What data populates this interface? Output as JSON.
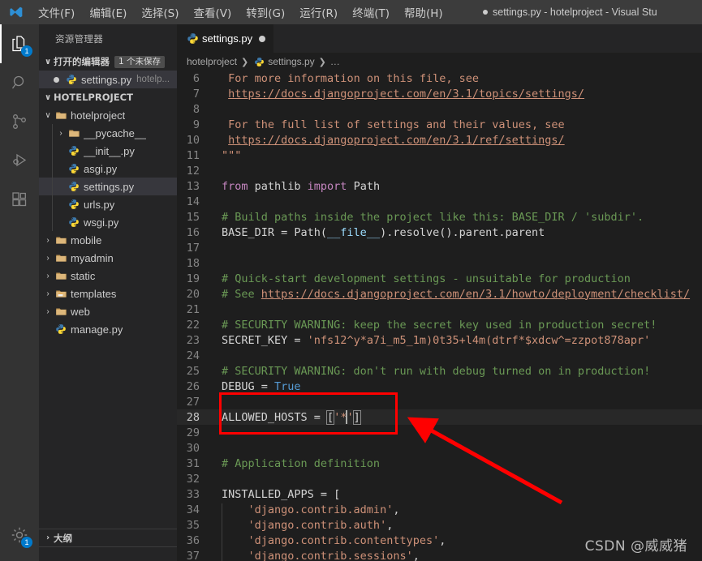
{
  "titlebar": {
    "logo": "vscode-logo",
    "menus": [
      {
        "label": "文件(F)"
      },
      {
        "label": "编辑(E)"
      },
      {
        "label": "选择(S)"
      },
      {
        "label": "查看(V)"
      },
      {
        "label": "转到(G)"
      },
      {
        "label": "运行(R)"
      },
      {
        "label": "终端(T)"
      },
      {
        "label": "帮助(H)"
      }
    ],
    "window_title": "settings.py - hotelproject - Visual Stu"
  },
  "activitybar": {
    "items": [
      {
        "name": "explorer",
        "icon": "files-icon",
        "badge": "1",
        "active": true
      },
      {
        "name": "search",
        "icon": "search-icon",
        "badge": "",
        "active": false
      },
      {
        "name": "source-control",
        "icon": "source-control-icon",
        "badge": "",
        "active": false
      },
      {
        "name": "run-debug",
        "icon": "run-and-debug-icon",
        "badge": "",
        "active": false
      },
      {
        "name": "extensions",
        "icon": "extensions-icon",
        "badge": "",
        "active": false
      }
    ],
    "manage": {
      "name": "manage",
      "icon": "gear-icon",
      "badge": "1"
    }
  },
  "sidebar": {
    "title": "资源管理器",
    "open_editors": {
      "label": "打开的编辑器",
      "badge": "1 个未保存",
      "items": [
        {
          "name": "settings.py",
          "description": "hotelp...",
          "icon": "python-icon",
          "dirty": true,
          "selected": true
        }
      ]
    },
    "project": {
      "label": "HOTELPROJECT",
      "tree": [
        {
          "label": "hotelproject",
          "icon": "folder-open-icon",
          "twisty": "∨",
          "depth": 1,
          "selected": false
        },
        {
          "label": "__pycache__",
          "icon": "folder-icon",
          "twisty": "›",
          "depth": 2,
          "selected": false
        },
        {
          "label": "__init__.py",
          "icon": "python-icon",
          "twisty": "",
          "depth": 2,
          "selected": false
        },
        {
          "label": "asgi.py",
          "icon": "python-icon",
          "twisty": "",
          "depth": 2,
          "selected": false
        },
        {
          "label": "settings.py",
          "icon": "python-icon",
          "twisty": "",
          "depth": 2,
          "selected": true
        },
        {
          "label": "urls.py",
          "icon": "python-icon",
          "twisty": "",
          "depth": 2,
          "selected": false
        },
        {
          "label": "wsgi.py",
          "icon": "python-icon",
          "twisty": "",
          "depth": 2,
          "selected": false
        },
        {
          "label": "mobile",
          "icon": "folder-icon",
          "twisty": "›",
          "depth": 1,
          "selected": false
        },
        {
          "label": "myadmin",
          "icon": "folder-icon",
          "twisty": "›",
          "depth": 1,
          "selected": false
        },
        {
          "label": "static",
          "icon": "folder-icon",
          "twisty": "›",
          "depth": 1,
          "selected": false
        },
        {
          "label": "templates",
          "icon": "folder-templates-icon",
          "twisty": "›",
          "depth": 1,
          "selected": false
        },
        {
          "label": "web",
          "icon": "folder-icon",
          "twisty": "›",
          "depth": 1,
          "selected": false
        },
        {
          "label": "manage.py",
          "icon": "python-icon",
          "twisty": "",
          "depth": 1,
          "selected": false
        }
      ]
    },
    "outline": {
      "label": "大纲",
      "twisty": "›"
    }
  },
  "editor": {
    "tabs": [
      {
        "label": "settings.py",
        "icon": "python-icon",
        "dirty": true,
        "active": true
      }
    ],
    "breadcrumbs": [
      {
        "label": "hotelproject",
        "icon": ""
      },
      {
        "label": "settings.py",
        "icon": "python-icon"
      },
      {
        "label": "…",
        "icon": ""
      }
    ],
    "first_line_number": 6,
    "active_line": 28,
    "lines": [
      {
        "n": 6,
        "indent": 0,
        "tokens": [
          {
            "t": "For more information on this file, see",
            "c": "c-str"
          }
        ],
        "pad": 1
      },
      {
        "n": 7,
        "indent": 0,
        "tokens": [
          {
            "t": "https://docs.djangoproject.com/en/3.1/topics/settings/",
            "c": "c-link"
          }
        ],
        "pad": 1
      },
      {
        "n": 8,
        "indent": 0,
        "tokens": []
      },
      {
        "n": 9,
        "indent": 0,
        "tokens": [
          {
            "t": "For the full list of settings and their values, see",
            "c": "c-str"
          }
        ],
        "pad": 1
      },
      {
        "n": 10,
        "indent": 0,
        "tokens": [
          {
            "t": "https://docs.djangoproject.com/en/3.1/ref/settings/",
            "c": "c-link"
          }
        ],
        "pad": 1
      },
      {
        "n": 11,
        "indent": 0,
        "tokens": [
          {
            "t": "\"\"\"",
            "c": "c-str"
          }
        ]
      },
      {
        "n": 12,
        "indent": 0,
        "tokens": []
      },
      {
        "n": 13,
        "indent": 0,
        "tokens": [
          {
            "t": "from",
            "c": "c-kw"
          },
          {
            "t": " pathlib ",
            "c": "c-plain"
          },
          {
            "t": "import",
            "c": "c-kw"
          },
          {
            "t": " Path",
            "c": "c-plain"
          }
        ]
      },
      {
        "n": 14,
        "indent": 0,
        "tokens": []
      },
      {
        "n": 15,
        "indent": 0,
        "tokens": [
          {
            "t": "# Build paths inside the project like this: BASE_DIR / 'subdir'.",
            "c": "c-com"
          }
        ]
      },
      {
        "n": 16,
        "indent": 0,
        "tokens": [
          {
            "t": "BASE_DIR = Path(",
            "c": "c-plain"
          },
          {
            "t": "__file__",
            "c": "c-var"
          },
          {
            "t": ").resolve().parent.parent",
            "c": "c-plain"
          }
        ]
      },
      {
        "n": 17,
        "indent": 0,
        "tokens": []
      },
      {
        "n": 18,
        "indent": 0,
        "tokens": []
      },
      {
        "n": 19,
        "indent": 0,
        "tokens": [
          {
            "t": "# Quick-start development settings - unsuitable for production",
            "c": "c-com"
          }
        ]
      },
      {
        "n": 20,
        "indent": 0,
        "tokens": [
          {
            "t": "# See ",
            "c": "c-com"
          },
          {
            "t": "https://docs.djangoproject.com/en/3.1/howto/deployment/checklist/",
            "c": "c-link"
          }
        ]
      },
      {
        "n": 21,
        "indent": 0,
        "tokens": []
      },
      {
        "n": 22,
        "indent": 0,
        "tokens": [
          {
            "t": "# SECURITY WARNING: keep the secret key used in production secret!",
            "c": "c-com"
          }
        ]
      },
      {
        "n": 23,
        "indent": 0,
        "tokens": [
          {
            "t": "SECRET_KEY = ",
            "c": "c-plain"
          },
          {
            "t": "'nfs12^y*a7i_m5_1m)0t35+l4m(dtrf*$xdcw^=zzpot878apr'",
            "c": "c-str"
          }
        ]
      },
      {
        "n": 24,
        "indent": 0,
        "tokens": []
      },
      {
        "n": 25,
        "indent": 0,
        "tokens": [
          {
            "t": "# SECURITY WARNING: don't run with debug turned on in production!",
            "c": "c-com"
          }
        ]
      },
      {
        "n": 26,
        "indent": 0,
        "tokens": [
          {
            "t": "DEBUG = ",
            "c": "c-plain"
          },
          {
            "t": "True",
            "c": "c-blue"
          }
        ]
      },
      {
        "n": 27,
        "indent": 0,
        "tokens": []
      },
      {
        "n": 28,
        "indent": 0,
        "tokens": [
          {
            "t": "ALLOWED_HOSTS = ",
            "c": "c-plain"
          },
          {
            "t": "[",
            "c": "c-punc bracket-hl"
          },
          {
            "t": "'*'",
            "c": "c-str",
            "cursor_after_index": 2
          },
          {
            "t": "]",
            "c": "c-punc bracket-hl"
          }
        ]
      },
      {
        "n": 29,
        "indent": 0,
        "tokens": []
      },
      {
        "n": 30,
        "indent": 0,
        "tokens": []
      },
      {
        "n": 31,
        "indent": 0,
        "tokens": [
          {
            "t": "# Application definition",
            "c": "c-com"
          }
        ]
      },
      {
        "n": 32,
        "indent": 0,
        "tokens": []
      },
      {
        "n": 33,
        "indent": 0,
        "tokens": [
          {
            "t": "INSTALLED_APPS = [",
            "c": "c-plain"
          }
        ]
      },
      {
        "n": 34,
        "indent": 1,
        "tokens": [
          {
            "t": "    'django.contrib.admin'",
            "c": "c-str"
          },
          {
            "t": ",",
            "c": "c-plain"
          }
        ]
      },
      {
        "n": 35,
        "indent": 1,
        "tokens": [
          {
            "t": "    'django.contrib.auth'",
            "c": "c-str"
          },
          {
            "t": ",",
            "c": "c-plain"
          }
        ]
      },
      {
        "n": 36,
        "indent": 1,
        "tokens": [
          {
            "t": "    'django.contrib.contenttypes'",
            "c": "c-str"
          },
          {
            "t": ",",
            "c": "c-plain"
          }
        ]
      },
      {
        "n": 37,
        "indent": 1,
        "tokens": [
          {
            "t": "    'django.contrib.sessions'",
            "c": "c-str"
          },
          {
            "t": ",",
            "c": "c-plain"
          }
        ]
      }
    ]
  },
  "annotations": {
    "highlight_box": {
      "name": "allowed-hosts-highlight",
      "color": "#ff0000"
    },
    "arrow": {
      "name": "red-arrow-annotation",
      "color": "#ff0000"
    },
    "watermark": "CSDN @威威猪"
  }
}
